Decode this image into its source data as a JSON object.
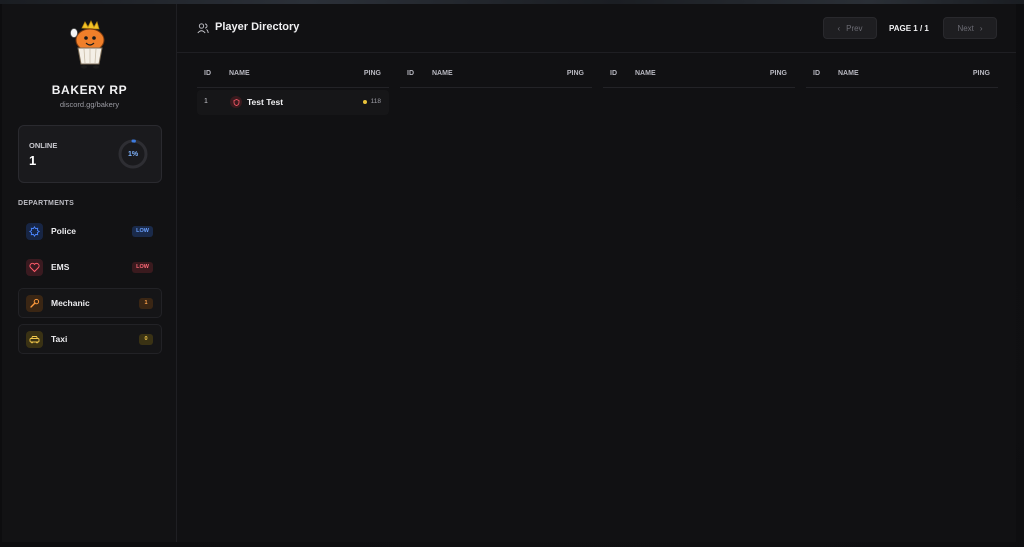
{
  "sidebar": {
    "brand": {
      "title": "BAKERY RP",
      "subtitle": "discord.gg/bakery"
    },
    "online": {
      "label": "ONLINE",
      "count": "1",
      "percent_label": "1%",
      "percent": 1,
      "ring_color": "#3d7be0"
    },
    "departments_heading": "DEPARTMENTS",
    "departments": [
      {
        "name": "Police",
        "badge": "LOW",
        "icon": "police-badge-icon",
        "color": "#4a86ff"
      },
      {
        "name": "EMS",
        "badge": "LOW",
        "icon": "heart-icon",
        "color": "#ff5a6a"
      },
      {
        "name": "Mechanic",
        "badge": "1",
        "icon": "wrench-icon",
        "color": "#ff9a3c"
      },
      {
        "name": "Taxi",
        "badge": "0",
        "icon": "taxi-icon",
        "color": "#f2c84b"
      }
    ]
  },
  "main": {
    "header": {
      "title": "Player Directory",
      "icon": "users-icon",
      "prev_label": "Prev",
      "next_label": "Next",
      "page_indicator": "PAGE 1 / 1"
    },
    "table": {
      "columns": {
        "id": "ID",
        "name": "NAME",
        "ping": "PING"
      },
      "rows": [
        {
          "id": "1",
          "name": "Test Test",
          "ping": "118",
          "icon": "shield-icon",
          "ping_color": "#e8c23a"
        }
      ]
    }
  }
}
